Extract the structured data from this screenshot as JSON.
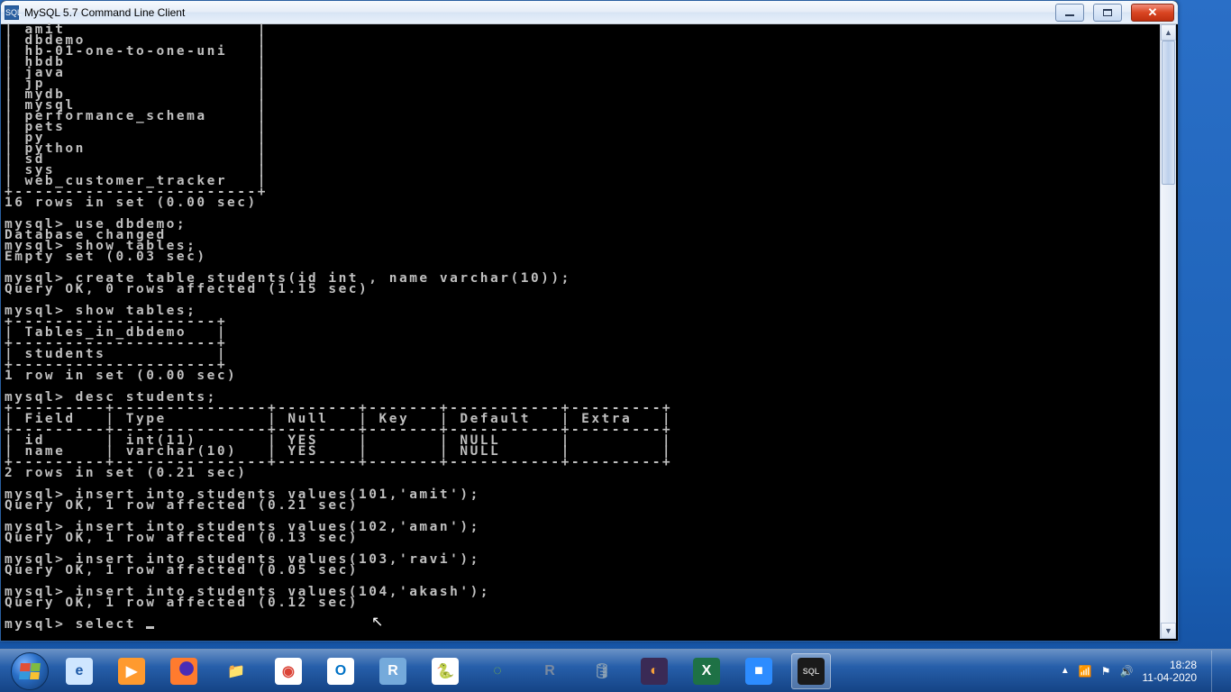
{
  "window": {
    "title": "MySQL 5.7 Command Line Client",
    "icon_label": "SQL"
  },
  "terminal": {
    "db_list": [
      "amit",
      "dbdemo",
      "hb-01-one-to-one-uni",
      "hbdb",
      "java",
      "jp",
      "mydb",
      "mysql",
      "performance_schema",
      "pets",
      "py",
      "python",
      "sd",
      "sys",
      "web_customer_tracker"
    ],
    "db_count_line": "16 rows in set (0.00 sec)",
    "use_cmd": "mysql> use dbdemo;",
    "use_resp": "Database changed",
    "show_tables1_cmd": "mysql> show tables;",
    "show_tables1_resp": "Empty set (0.03 sec)",
    "create_cmd": "mysql> create table students(id int , name varchar(10));",
    "create_resp": "Query OK, 0 rows affected (1.15 sec)",
    "show_tables2_cmd": "mysql> show tables;",
    "tables_header": "Tables_in_dbdemo",
    "tables_row": "students",
    "tables_count": "1 row in set (0.00 sec)",
    "desc_cmd": "mysql> desc students;",
    "desc_headers": [
      "Field",
      "Type",
      "Null",
      "Key",
      "Default",
      "Extra"
    ],
    "desc_rows": [
      {
        "Field": "id",
        "Type": "int(11)",
        "Null": "YES",
        "Key": "",
        "Default": "NULL",
        "Extra": ""
      },
      {
        "Field": "name",
        "Type": "varchar(10)",
        "Null": "YES",
        "Key": "",
        "Default": "NULL",
        "Extra": ""
      }
    ],
    "desc_count": "2 rows in set (0.21 sec)",
    "inserts": [
      {
        "cmd": "mysql> insert into students values(101,'amit');",
        "resp": "Query OK, 1 row affected (0.21 sec)"
      },
      {
        "cmd": "mysql> insert into students values(102,'aman');",
        "resp": "Query OK, 1 row affected (0.13 sec)"
      },
      {
        "cmd": "mysql> insert into students values(103,'ravi');",
        "resp": "Query OK, 1 row affected (0.05 sec)"
      },
      {
        "cmd": "mysql> insert into students values(104,'akash');",
        "resp": "Query OK, 1 row affected (0.12 sec)"
      }
    ],
    "prompt_tail": "mysql> select "
  },
  "taskbar": {
    "icons": [
      {
        "name": "internet-explorer-icon",
        "glyph": "e",
        "bg": "#cfe6ff",
        "fg": "#1e5aa8"
      },
      {
        "name": "media-player-icon",
        "glyph": "▶",
        "bg": "#ff9a2e",
        "fg": "#fff"
      },
      {
        "name": "firefox-icon",
        "glyph": "",
        "bg": "#ff7b2e",
        "fg": "#4a2db4"
      },
      {
        "name": "file-explorer-icon",
        "glyph": "📁",
        "bg": "transparent",
        "fg": "#f6d56b"
      },
      {
        "name": "chrome-icon",
        "glyph": "◉",
        "bg": "#fff",
        "fg": "#db4437"
      },
      {
        "name": "outlook-icon",
        "glyph": "O",
        "bg": "#fff",
        "fg": "#0072c6"
      },
      {
        "name": "rstudio-icon",
        "glyph": "R",
        "bg": "#75aadb",
        "fg": "#fff"
      },
      {
        "name": "python-icon",
        "glyph": "🐍",
        "bg": "#fff",
        "fg": "#306998"
      },
      {
        "name": "loading-icon",
        "glyph": "◌",
        "bg": "transparent",
        "fg": "#7db73f"
      },
      {
        "name": "r-icon",
        "glyph": "R",
        "bg": "transparent",
        "fg": "#7a8aa0"
      },
      {
        "name": "database-icon",
        "glyph": "🛢",
        "bg": "transparent",
        "fg": "#8aa0b4"
      },
      {
        "name": "eclipse-icon",
        "glyph": "◐",
        "bg": "#3a2a55",
        "fg": "#f7a13b"
      },
      {
        "name": "excel-icon",
        "glyph": "X",
        "bg": "#1e7145",
        "fg": "#fff"
      },
      {
        "name": "zoom-icon",
        "glyph": "■",
        "bg": "#2d8cff",
        "fg": "#fff"
      },
      {
        "name": "mysql-shell-icon",
        "glyph": "SQL",
        "bg": "#1a1a1a",
        "fg": "#c0c0c0"
      }
    ],
    "active_index": 14,
    "clock_time": "18:28",
    "clock_date": "11-04-2020"
  }
}
